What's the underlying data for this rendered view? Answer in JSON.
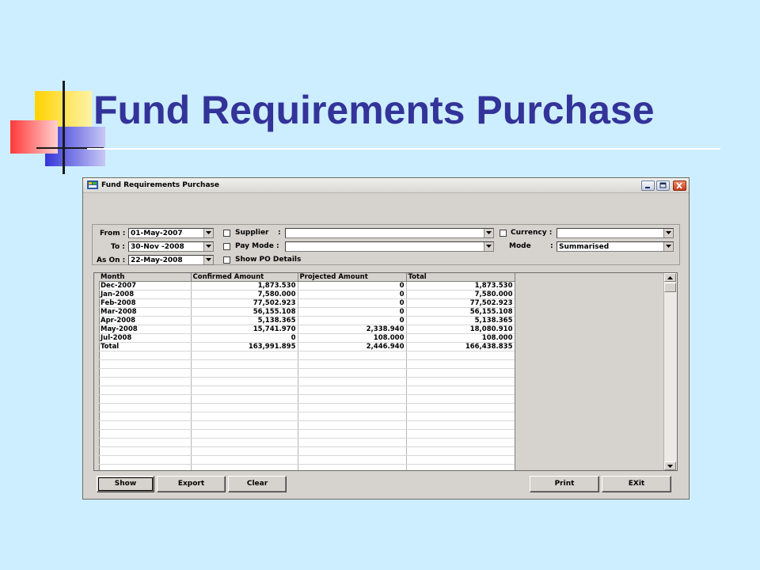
{
  "slide": {
    "title": "Fund Requirements Purchase"
  },
  "window": {
    "title": "Fund Requirements Purchase",
    "app_icon": "app-icon",
    "controls": [
      "minimize-icon",
      "maximize-icon",
      "close-icon"
    ]
  },
  "filters": {
    "from_label": "From :",
    "from_value": "01-May-2007",
    "to_label": "To :",
    "to_value": "30-Nov -2008",
    "as_on_label": "As On :",
    "as_on_value": "22-May-2008",
    "supplier_label": "Supplier",
    "supplier_colon": ":",
    "supplier_value": "",
    "pay_mode_label": "Pay Mode :",
    "pay_mode_value": "",
    "show_po_label": "Show PO Details",
    "currency_label": "Currency :",
    "currency_value": "",
    "mode_label": "Mode",
    "mode_colon": ":",
    "mode_value": "Summarised"
  },
  "grid": {
    "columns": [
      "Month",
      "Confirmed  Amount",
      "Projected Amount",
      "Total"
    ],
    "rows": [
      [
        "Dec-2007",
        "1,873.530",
        "0",
        "1,873.530"
      ],
      [
        "Jan-2008",
        "7,580.000",
        "0",
        "7,580.000"
      ],
      [
        "Feb-2008",
        "77,502.923",
        "0",
        "77,502.923"
      ],
      [
        "Mar-2008",
        "56,155.108",
        "0",
        "56,155.108"
      ],
      [
        "Apr-2008",
        "5,138.365",
        "0",
        "5,138.365"
      ],
      [
        "May-2008",
        "15,741.970",
        "2,338.940",
        "18,080.910"
      ],
      [
        "Jul-2008",
        "0",
        "108.000",
        "108.000"
      ],
      [
        "Total",
        "163,991.895",
        "2,446.940",
        "166,438.835"
      ]
    ]
  },
  "buttons": {
    "show": "Show",
    "export": "Export",
    "clear": "Clear",
    "print": "Print",
    "exit": "EXit"
  },
  "colors": {
    "slide_background": "#cdeeff",
    "title": "#333399",
    "window_face": "#d6d3ce"
  }
}
